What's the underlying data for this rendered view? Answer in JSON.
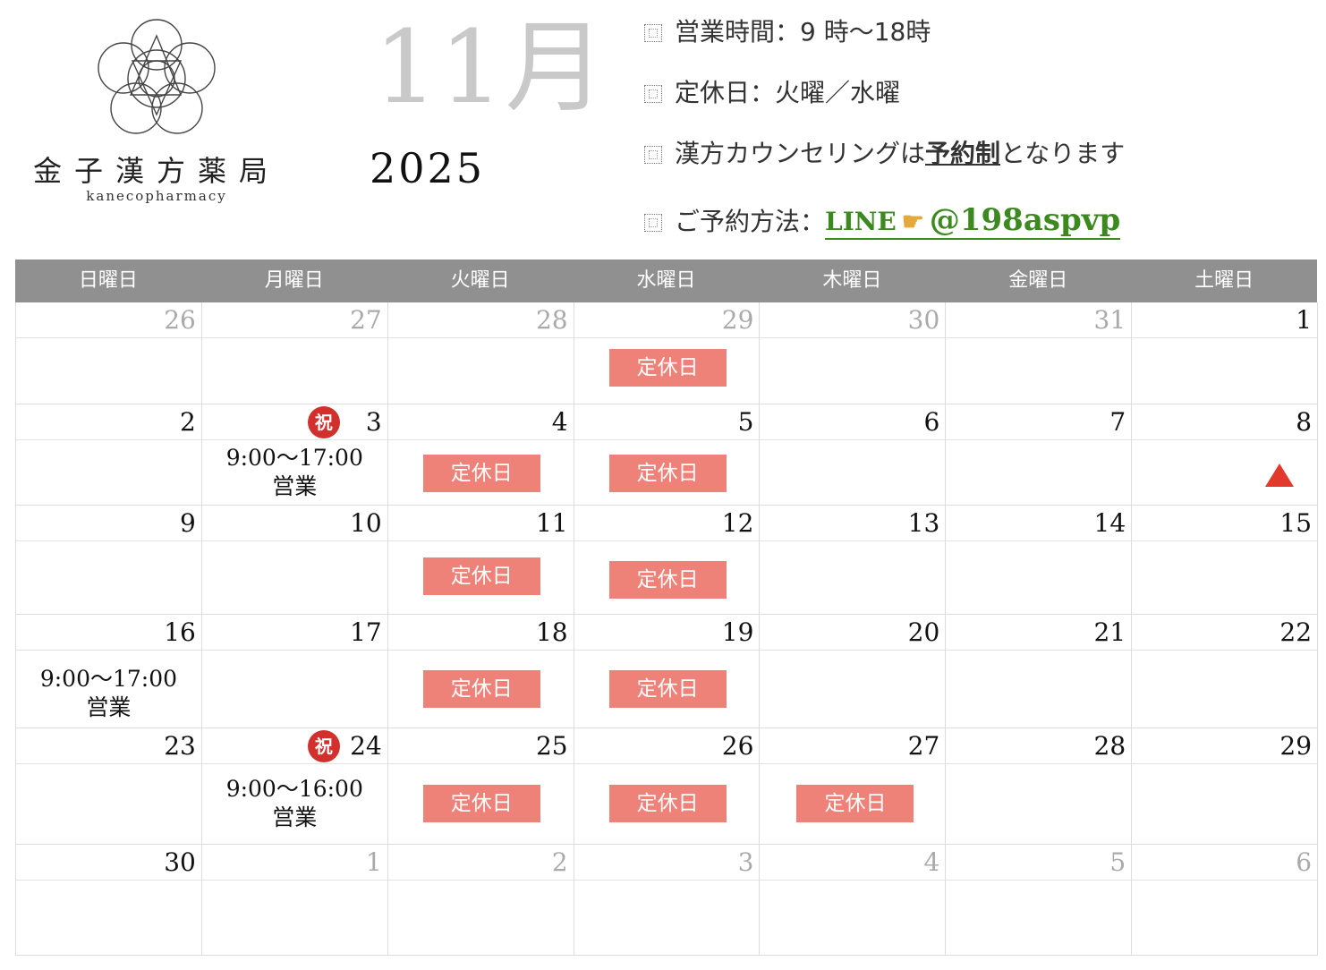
{
  "logo": {
    "name": "金子漢方薬局",
    "sub": "kanecopharmacy"
  },
  "calendar_title": {
    "month": "11月",
    "year": "2025"
  },
  "info": {
    "hours": "営業時間：9 時〜18時",
    "closed_days": "定休日：火曜／水曜",
    "counseling_pre": "漢方カウンセリングは",
    "counseling_bold": "予約制",
    "counseling_post": "となります",
    "reserve_pre": "ご予約方法：",
    "line_label": "LINE",
    "line_id": "@198aspvp"
  },
  "weekdays": [
    "日曜日",
    "月曜日",
    "火曜日",
    "水曜日",
    "木曜日",
    "金曜日",
    "土曜日"
  ],
  "labels": {
    "closed": "定休日",
    "holiday": "祝",
    "open": "営業"
  },
  "weeks": [
    [
      "26",
      "27",
      "28",
      "29",
      "30",
      "31",
      "1"
    ],
    [
      "2",
      "3",
      "4",
      "5",
      "6",
      "7",
      "8"
    ],
    [
      "9",
      "10",
      "11",
      "12",
      "13",
      "14",
      "15"
    ],
    [
      "16",
      "17",
      "18",
      "19",
      "20",
      "21",
      "22"
    ],
    [
      "23",
      "24",
      "25",
      "26",
      "27",
      "28",
      "29"
    ],
    [
      "30",
      "1",
      "2",
      "3",
      "4",
      "5",
      "6"
    ]
  ],
  "hours_notes": {
    "nov3": "9:00〜17:00",
    "nov16": "9:00〜17:00",
    "nov24": "9:00〜16:00"
  },
  "colors": {
    "closed_bg": "#ee8279",
    "header_bg": "#909090",
    "line_green": "#3c8a1f",
    "holiday_red": "#d2302c"
  }
}
